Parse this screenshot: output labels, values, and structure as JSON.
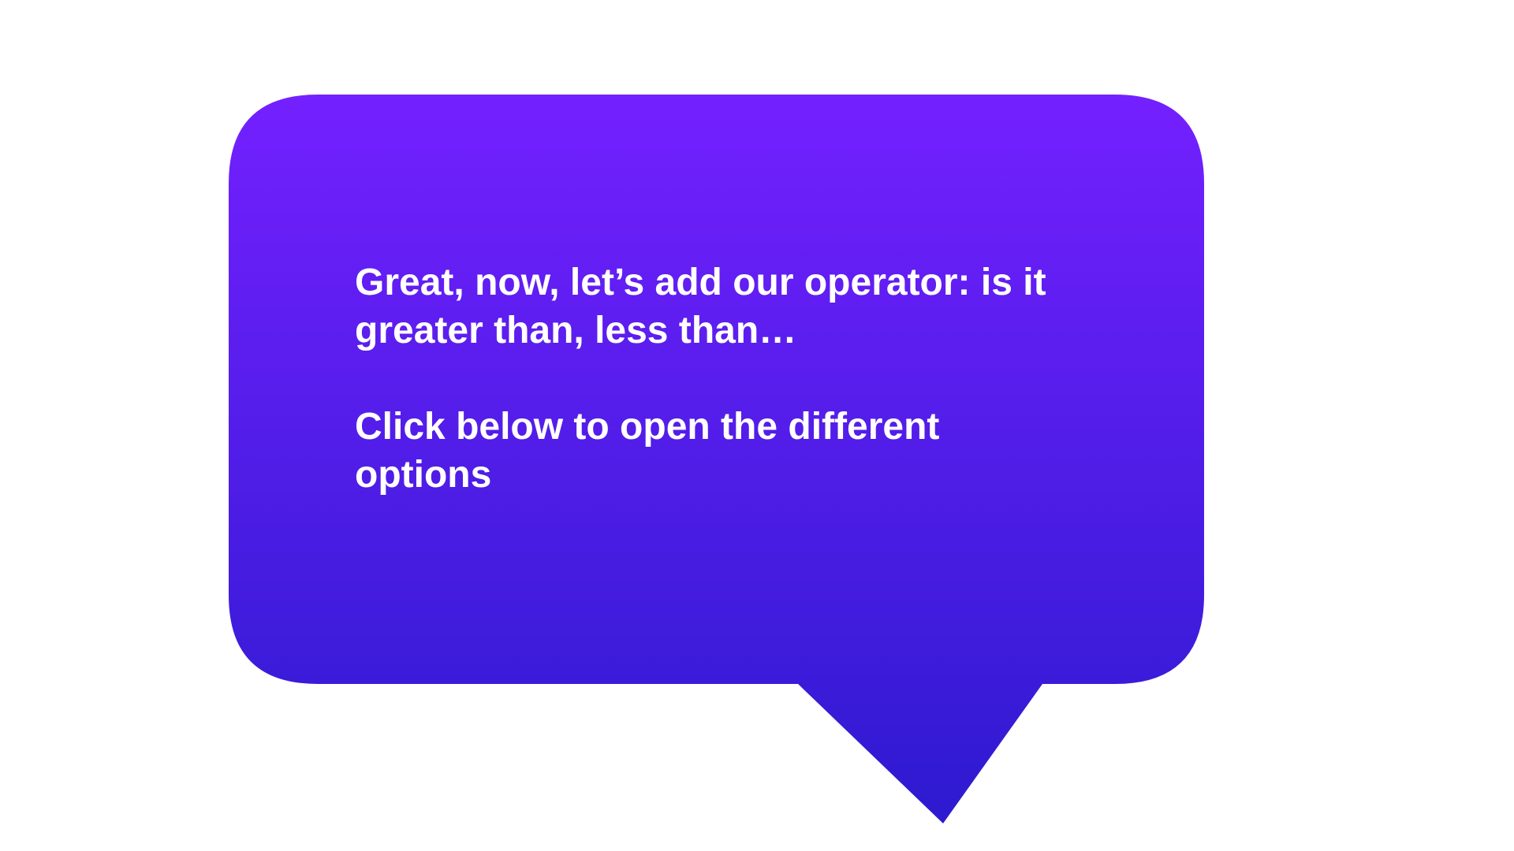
{
  "tooltip": {
    "message_line_1": "Great, now, let’s add our operator: is it\ngreater than, less than…",
    "message_line_2": "Click below to open the different\noptions",
    "colors": {
      "gradient_top": "#7420FF",
      "gradient_bottom": "#2D1AD0",
      "text": "#FFFFFF",
      "background": "#FFFFFF"
    }
  }
}
